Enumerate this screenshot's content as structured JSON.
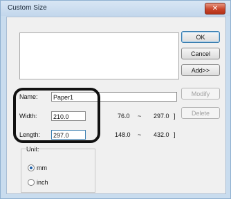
{
  "window": {
    "title": "Custom Size",
    "close_glyph": "✕"
  },
  "buttons": {
    "ok": "OK",
    "cancel": "Cancel",
    "add": "Add>>",
    "modify": "Modify",
    "delete": "Delete"
  },
  "form": {
    "name_label": "Name:",
    "name_value": "Paper1",
    "width_label": "Width:",
    "width_value": "210.0",
    "width_range_open": "[",
    "width_range_min": "76.0",
    "width_range_sep": "~",
    "width_range_max": "297.0",
    "width_range_close": "]",
    "length_label": "Length:",
    "length_value": "297.0",
    "length_range_open": "[",
    "length_range_min": "148.0",
    "length_range_sep": "~",
    "length_range_max": "432.0",
    "length_range_close": "]"
  },
  "unit": {
    "label": "Unit:",
    "options": [
      "mm",
      "inch"
    ],
    "selected": "mm"
  },
  "colors": {
    "highlight_border": "#111111",
    "close_button": "#c9452b"
  }
}
